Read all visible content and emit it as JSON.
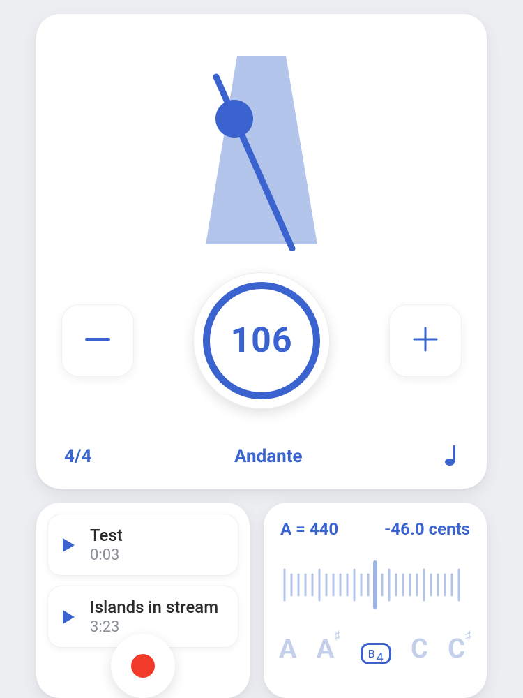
{
  "metronome": {
    "bpm": "106",
    "time_signature": "4/4",
    "tempo_name": "Andante",
    "note_value_icon": "quarter-note"
  },
  "recordings": [
    {
      "title": "Test",
      "duration": "0:03"
    },
    {
      "title": "Islands in stream",
      "duration": "3:23"
    }
  ],
  "tuner": {
    "reference": "A = 440",
    "cents": "-46.0 cents",
    "notes": [
      "A",
      "A♯",
      "B",
      "C",
      "C♯"
    ],
    "active_note": "B",
    "active_octave": "4"
  }
}
